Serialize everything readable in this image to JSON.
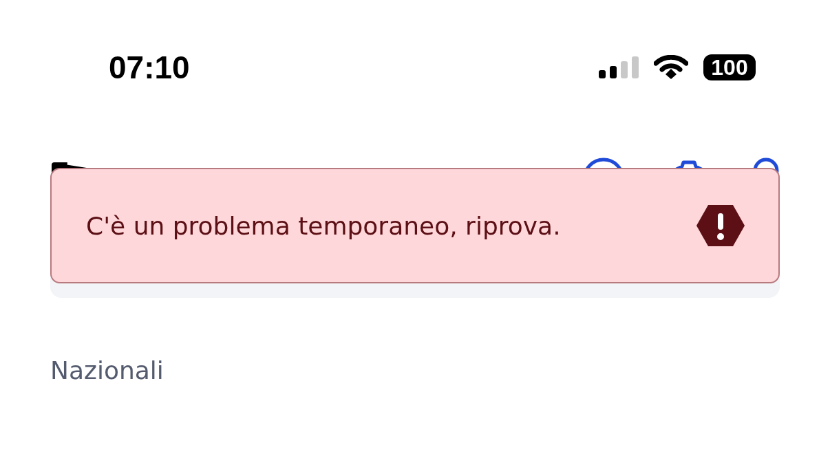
{
  "status_bar": {
    "time": "07:10",
    "battery": "100"
  },
  "toast": {
    "message": "C'è un problema temporaneo, riprova."
  },
  "section": {
    "title": "Nazionali"
  }
}
